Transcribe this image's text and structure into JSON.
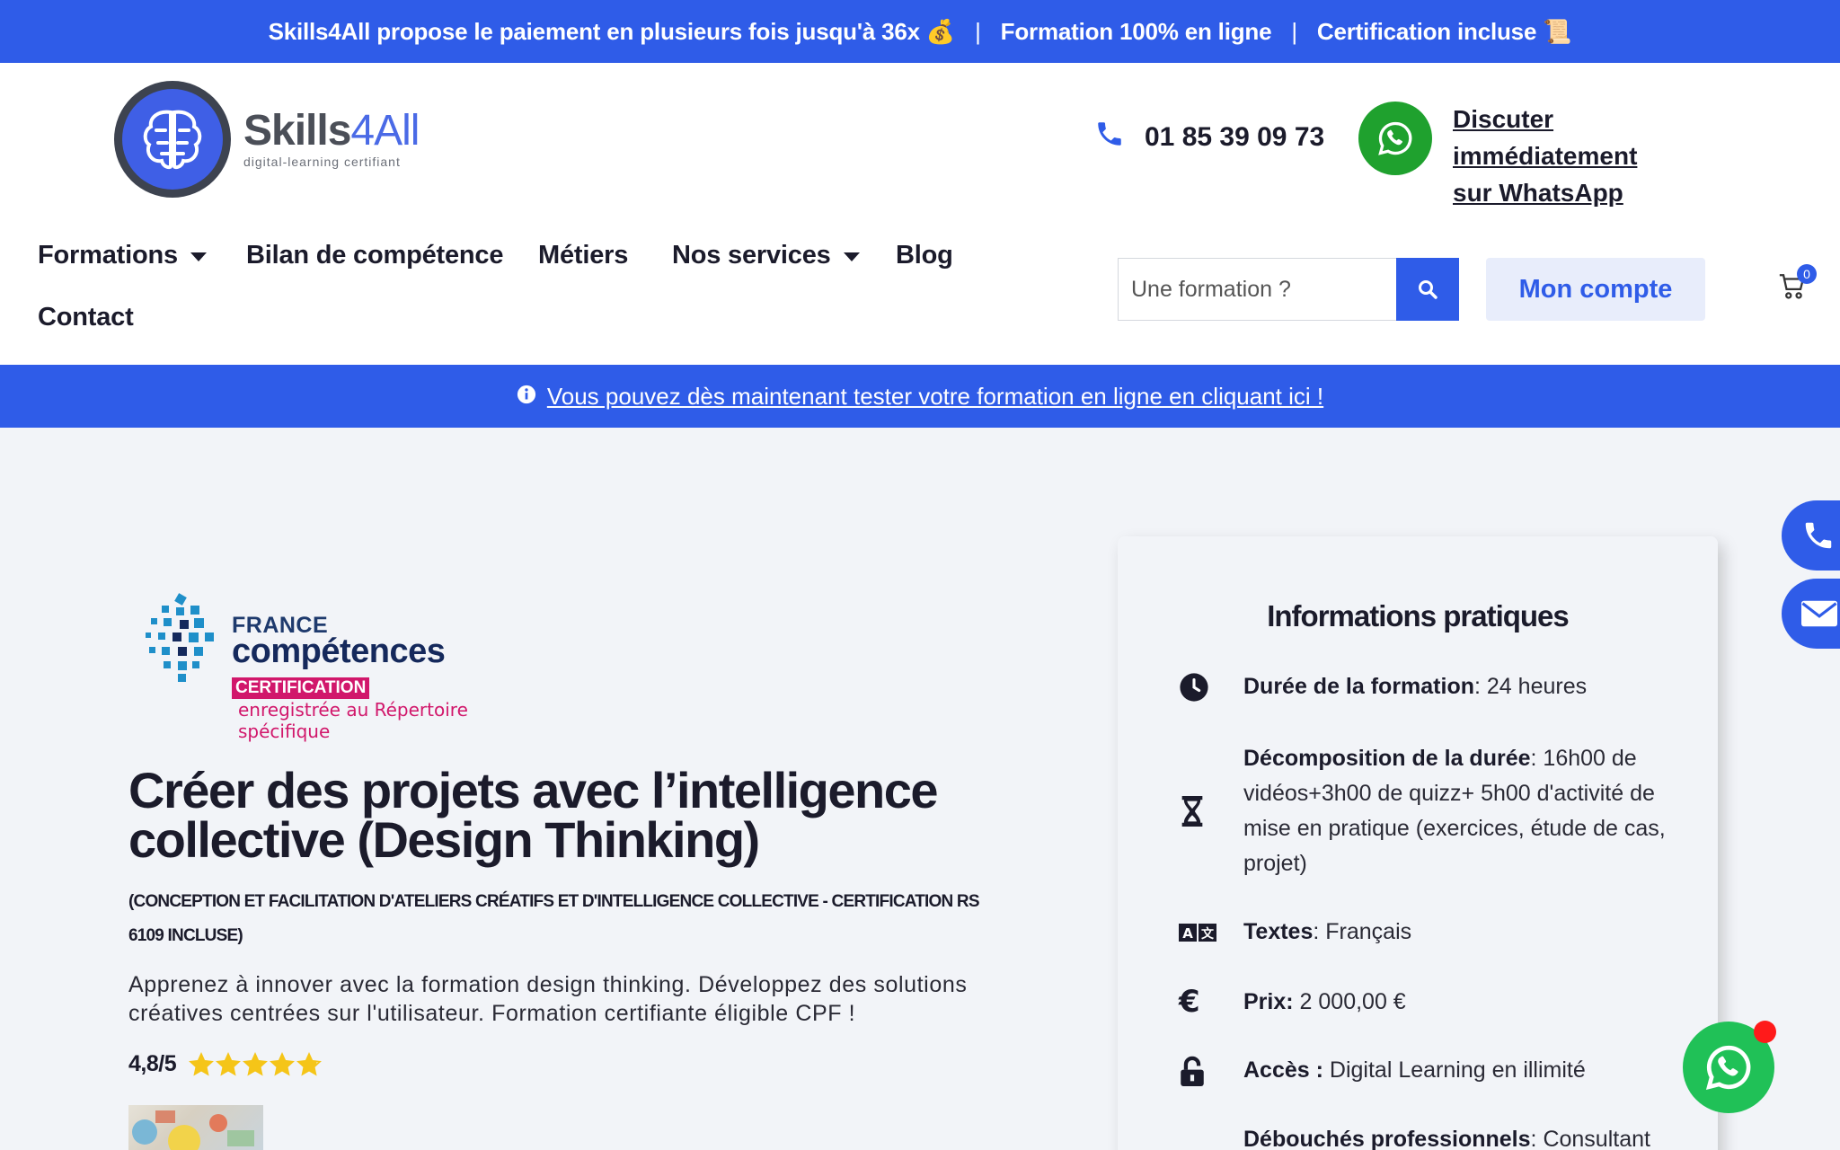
{
  "promo": {
    "segment1": "Skills4All propose le paiement en plusieurs fois jusqu'à 36x 💰",
    "segment2": "Formation 100% en ligne",
    "segment3": "Certification incluse 📜",
    "separator": "|"
  },
  "header": {
    "logo_name_main": "Skills",
    "logo_name_accent": "4All",
    "logo_tagline": "digital-learning certifiant",
    "phone_number": "01 85 39 09 73",
    "whatsapp_link_line1": "Discuter immédiatement",
    "whatsapp_link_line2": "sur WhatsApp"
  },
  "nav": {
    "items": [
      {
        "label": "Formations",
        "dropdown": true
      },
      {
        "label": "Bilan de compétence",
        "dropdown": false
      },
      {
        "label": "Métiers",
        "dropdown": false
      },
      {
        "label": "Nos services",
        "dropdown": true
      },
      {
        "label": "Blog",
        "dropdown": false
      },
      {
        "label": "Contact",
        "dropdown": false
      }
    ]
  },
  "search": {
    "placeholder": "Une formation ?",
    "icon": "search-icon"
  },
  "account": {
    "label": "Mon compte"
  },
  "cart": {
    "count": "0",
    "icon": "cart-icon"
  },
  "banner": {
    "text": "Vous pouvez dès maintenant tester votre formation en ligne en cliquant ici !",
    "icon": "info-icon"
  },
  "certification_logo": {
    "line1": "FRANCE",
    "line2": "compétences",
    "badge": "CERTIFICATION",
    "line3": "enregistrée au Répertoire spécifique"
  },
  "course": {
    "title": "Créer des projets avec l’intelligence collective (Design Thinking)",
    "subtitle": "(CONCEPTION ET FACILITATION D'ATELIERS CRÉATIFS ET D'INTELLIGENCE COLLECTIVE - CERTIFICATION RS 6109 INCLUSE)",
    "description": "Apprenez à innover avec la formation design thinking. Développez des solutions créatives centrées sur l'utilisateur. Formation certifiante éligible CPF !",
    "rating_text": "4,8/5",
    "rating_value": 4.8,
    "rating_max": 5
  },
  "info_card": {
    "title": "Informations pratiques",
    "rows": [
      {
        "icon": "clock-icon",
        "label": "Durée de la formation",
        "sep": ": ",
        "value": "24 heures"
      },
      {
        "icon": "hourglass-icon",
        "label": "Décomposition de la durée",
        "sep": ": ",
        "value": "16h00 de vidéos+3h00 de quizz+ 5h00 d'activité de mise en pratique (exercices, étude de cas, projet)"
      },
      {
        "icon": "translate-icon",
        "label": "Textes",
        "sep": ": ",
        "value": "Français"
      },
      {
        "icon": "euro-icon",
        "label": "Prix:",
        "sep": " ",
        "value": "2 000,00 €"
      },
      {
        "icon": "unlock-icon",
        "label": "Accès :",
        "sep": " ",
        "value": "Digital Learning en illimité"
      },
      {
        "icon": "",
        "label": "Débouchés professionnels",
        "sep": ": ",
        "value": "Consultant"
      }
    ]
  },
  "colors": {
    "brand_blue": "#2f5ce8",
    "whatsapp_green": "#1fa12e",
    "star_yellow": "#f5c518",
    "certification_pink": "#d1176b"
  }
}
